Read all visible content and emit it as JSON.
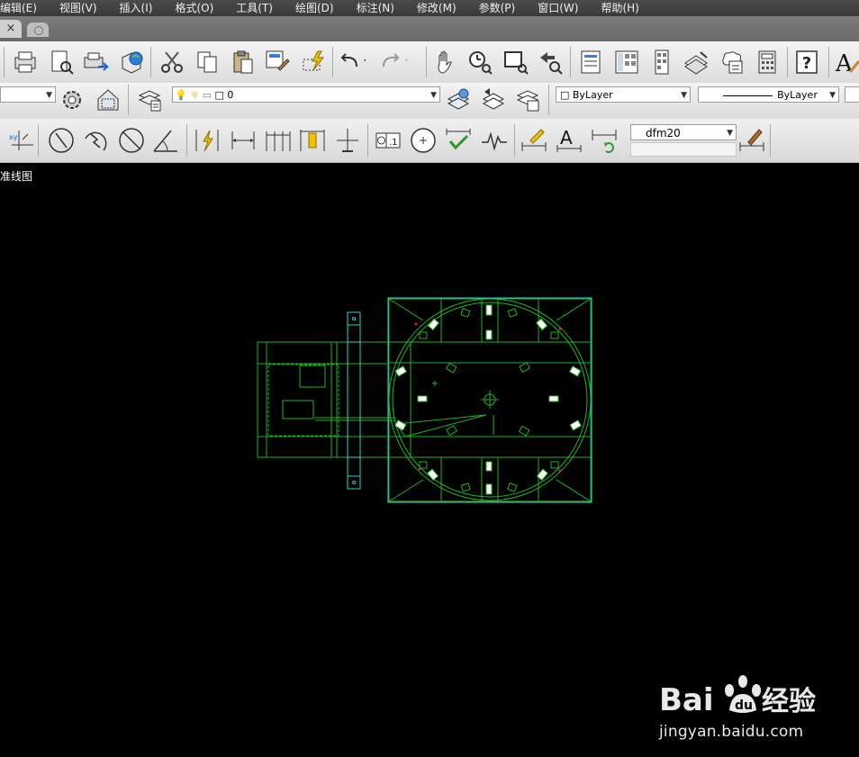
{
  "menu": [
    "编辑(E)",
    "视图(V)",
    "插入(I)",
    "格式(O)",
    "工具(T)",
    "绘图(D)",
    "标注(N)",
    "修改(M)",
    "参数(P)",
    "窗口(W)",
    "帮助(H)"
  ],
  "tabs": {
    "close_glyph": "×"
  },
  "layer": {
    "current": "0"
  },
  "properties": {
    "color": "ByLayer",
    "linetype": "ByLayer"
  },
  "dim_style": "dfm20",
  "canvas": {
    "label": "准线图"
  },
  "watermark": {
    "brand": "Baidu经验",
    "url": "jingyan.baidu.com"
  },
  "colors": {
    "drawing_green": "#1fb61f",
    "drawing_cyan": "#2fd0d0",
    "canvas_bg": "#000000"
  }
}
